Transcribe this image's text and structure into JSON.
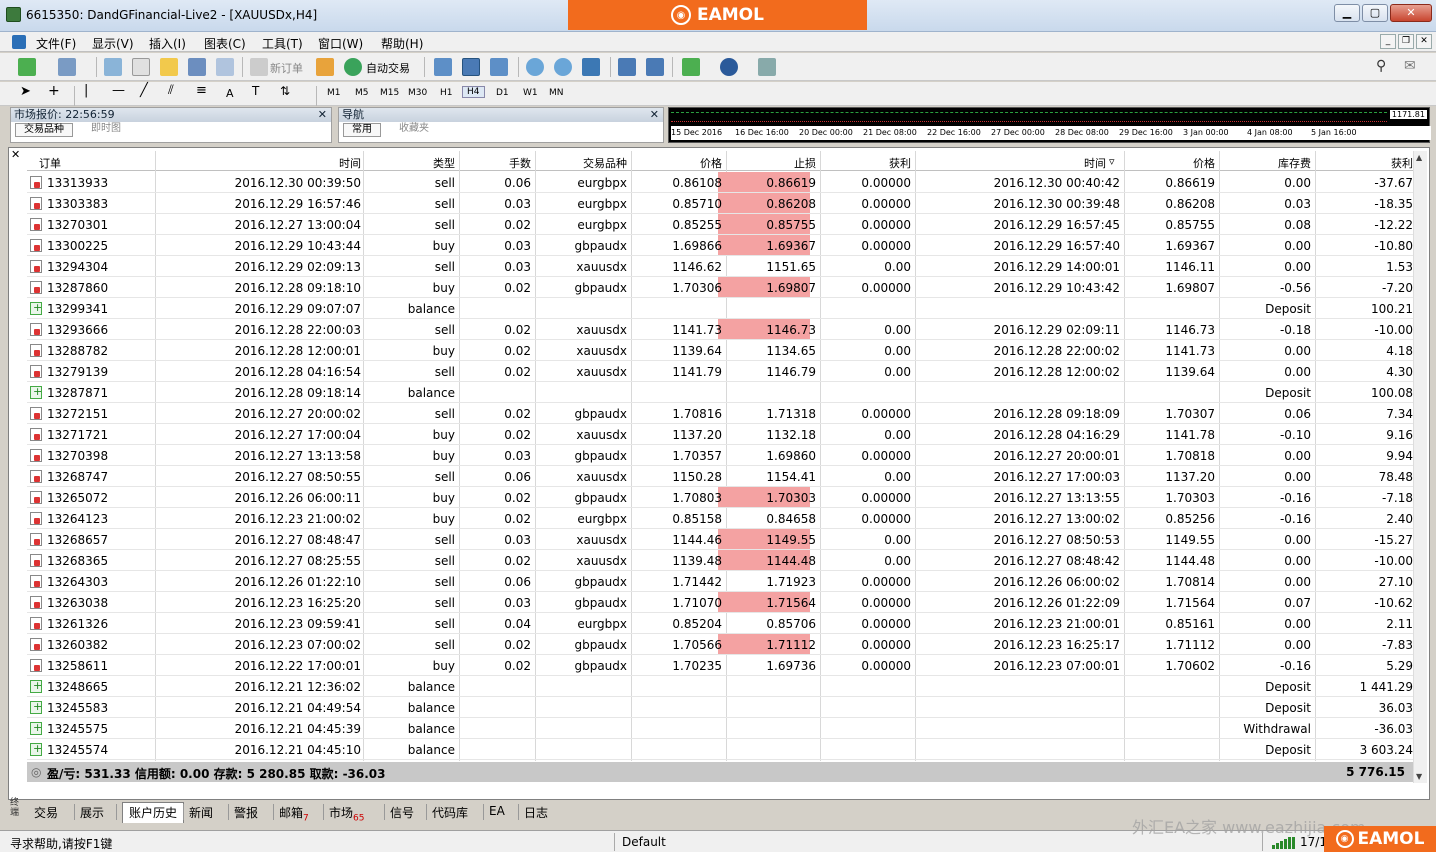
{
  "window": {
    "title": "6615350: DandGFinancial-Live2 - [XAUUSDx,H4]",
    "banner": "EAMOL"
  },
  "menu": [
    "文件(F)",
    "显示(V)",
    "插入(I)",
    "图表(C)",
    "工具(T)",
    "窗口(W)",
    "帮助(H)"
  ],
  "toolbar": {
    "new_order": "新订单",
    "auto_trading": "自动交易",
    "timeframes": [
      "M1",
      "M5",
      "M15",
      "M30",
      "H1",
      "H4",
      "D1",
      "W1",
      "MN"
    ],
    "text_tool": "A"
  },
  "panels": {
    "market": {
      "title": "市场报价: 22:56:59",
      "tabs": [
        "交易品种",
        "即时图"
      ]
    },
    "nav": {
      "title": "导航",
      "tabs": [
        "常用",
        "收藏夹"
      ]
    }
  },
  "chart": {
    "price": "1171.81",
    "dates": [
      "15 Dec 2016",
      "16 Dec 16:00",
      "20 Dec 00:00",
      "21 Dec 08:00",
      "22 Dec 16:00",
      "27 Dec 00:00",
      "28 Dec 08:00",
      "29 Dec 16:00",
      "3 Jan 00:00",
      "4 Jan 08:00",
      "5 Jan 16:00"
    ]
  },
  "columns": [
    "订单",
    "时间",
    "类型",
    "手数",
    "交易品种",
    "价格",
    "止损",
    "获利",
    "时间",
    "价格",
    "库存费",
    "获利"
  ],
  "rows": [
    {
      "order": "13313933",
      "open": "2016.12.30 00:39:50",
      "type": "sell",
      "lots": "0.06",
      "sym": "eurgbpx",
      "price": "0.86108",
      "sl": "0.86619",
      "tp": "0.00000",
      "close": "2016.12.30 00:40:42",
      "cprice": "0.86619",
      "swap": "0.00",
      "profit": "-37.67",
      "hit": true
    },
    {
      "order": "13303383",
      "open": "2016.12.29 16:57:46",
      "type": "sell",
      "lots": "0.03",
      "sym": "eurgbpx",
      "price": "0.85710",
      "sl": "0.86208",
      "tp": "0.00000",
      "close": "2016.12.30 00:39:48",
      "cprice": "0.86208",
      "swap": "0.03",
      "profit": "-18.35",
      "hit": true
    },
    {
      "order": "13270301",
      "open": "2016.12.27 13:00:04",
      "type": "sell",
      "lots": "0.02",
      "sym": "eurgbpx",
      "price": "0.85255",
      "sl": "0.85755",
      "tp": "0.00000",
      "close": "2016.12.29 16:57:45",
      "cprice": "0.85755",
      "swap": "0.08",
      "profit": "-12.22",
      "hit": true
    },
    {
      "order": "13300225",
      "open": "2016.12.29 10:43:44",
      "type": "buy",
      "lots": "0.03",
      "sym": "gbpaudx",
      "price": "1.69866",
      "sl": "1.69367",
      "tp": "0.00000",
      "close": "2016.12.29 16:57:40",
      "cprice": "1.69367",
      "swap": "0.00",
      "profit": "-10.80",
      "hit": true
    },
    {
      "order": "13294304",
      "open": "2016.12.29 02:09:13",
      "type": "sell",
      "lots": "0.03",
      "sym": "xauusdx",
      "price": "1146.62",
      "sl": "1151.65",
      "tp": "0.00",
      "close": "2016.12.29 14:00:01",
      "cprice": "1146.11",
      "swap": "0.00",
      "profit": "1.53",
      "hit": false
    },
    {
      "order": "13287860",
      "open": "2016.12.28 09:18:10",
      "type": "buy",
      "lots": "0.02",
      "sym": "gbpaudx",
      "price": "1.70306",
      "sl": "1.69807",
      "tp": "0.00000",
      "close": "2016.12.29 10:43:42",
      "cprice": "1.69807",
      "swap": "-0.56",
      "profit": "-7.20",
      "hit": true
    },
    {
      "order": "13299341",
      "open": "2016.12.29 09:07:07",
      "type": "balance",
      "comment": "Deposit",
      "profit": "100.21"
    },
    {
      "order": "13293666",
      "open": "2016.12.28 22:00:03",
      "type": "sell",
      "lots": "0.02",
      "sym": "xauusdx",
      "price": "1141.73",
      "sl": "1146.73",
      "tp": "0.00",
      "close": "2016.12.29 02:09:11",
      "cprice": "1146.73",
      "swap": "-0.18",
      "profit": "-10.00",
      "hit": true
    },
    {
      "order": "13288782",
      "open": "2016.12.28 12:00:01",
      "type": "buy",
      "lots": "0.02",
      "sym": "xauusdx",
      "price": "1139.64",
      "sl": "1134.65",
      "tp": "0.00",
      "close": "2016.12.28 22:00:02",
      "cprice": "1141.73",
      "swap": "0.00",
      "profit": "4.18",
      "hit": false
    },
    {
      "order": "13279139",
      "open": "2016.12.28 04:16:54",
      "type": "sell",
      "lots": "0.02",
      "sym": "xauusdx",
      "price": "1141.79",
      "sl": "1146.79",
      "tp": "0.00",
      "close": "2016.12.28 12:00:02",
      "cprice": "1139.64",
      "swap": "0.00",
      "profit": "4.30",
      "hit": false
    },
    {
      "order": "13287871",
      "open": "2016.12.28 09:18:14",
      "type": "balance",
      "comment": "Deposit",
      "profit": "100.08"
    },
    {
      "order": "13272151",
      "open": "2016.12.27 20:00:02",
      "type": "sell",
      "lots": "0.02",
      "sym": "gbpaudx",
      "price": "1.70816",
      "sl": "1.71318",
      "tp": "0.00000",
      "close": "2016.12.28 09:18:09",
      "cprice": "1.70307",
      "swap": "0.06",
      "profit": "7.34",
      "hit": false
    },
    {
      "order": "13271721",
      "open": "2016.12.27 17:00:04",
      "type": "buy",
      "lots": "0.02",
      "sym": "xauusdx",
      "price": "1137.20",
      "sl": "1132.18",
      "tp": "0.00",
      "close": "2016.12.28 04:16:29",
      "cprice": "1141.78",
      "swap": "-0.10",
      "profit": "9.16",
      "hit": false
    },
    {
      "order": "13270398",
      "open": "2016.12.27 13:13:58",
      "type": "buy",
      "lots": "0.03",
      "sym": "gbpaudx",
      "price": "1.70357",
      "sl": "1.69860",
      "tp": "0.00000",
      "close": "2016.12.27 20:00:01",
      "cprice": "1.70818",
      "swap": "0.00",
      "profit": "9.94",
      "hit": false
    },
    {
      "order": "13268747",
      "open": "2016.12.27 08:50:55",
      "type": "sell",
      "lots": "0.06",
      "sym": "xauusdx",
      "price": "1150.28",
      "sl": "1154.41",
      "tp": "0.00",
      "close": "2016.12.27 17:00:03",
      "cprice": "1137.20",
      "swap": "0.00",
      "profit": "78.48",
      "hit": false
    },
    {
      "order": "13265072",
      "open": "2016.12.26 06:00:11",
      "type": "buy",
      "lots": "0.02",
      "sym": "gbpaudx",
      "price": "1.70803",
      "sl": "1.70303",
      "tp": "0.00000",
      "close": "2016.12.27 13:13:55",
      "cprice": "1.70303",
      "swap": "-0.16",
      "profit": "-7.18",
      "hit": true
    },
    {
      "order": "13264123",
      "open": "2016.12.23 21:00:02",
      "type": "buy",
      "lots": "0.02",
      "sym": "eurgbpx",
      "price": "0.85158",
      "sl": "0.84658",
      "tp": "0.00000",
      "close": "2016.12.27 13:00:02",
      "cprice": "0.85256",
      "swap": "-0.16",
      "profit": "2.40",
      "hit": false
    },
    {
      "order": "13268657",
      "open": "2016.12.27 08:48:47",
      "type": "sell",
      "lots": "0.03",
      "sym": "xauusdx",
      "price": "1144.46",
      "sl": "1149.55",
      "tp": "0.00",
      "close": "2016.12.27 08:50:53",
      "cprice": "1149.55",
      "swap": "0.00",
      "profit": "-15.27",
      "hit": true
    },
    {
      "order": "13268365",
      "open": "2016.12.27 08:25:55",
      "type": "sell",
      "lots": "0.02",
      "sym": "xauusdx",
      "price": "1139.48",
      "sl": "1144.48",
      "tp": "0.00",
      "close": "2016.12.27 08:48:42",
      "cprice": "1144.48",
      "swap": "0.00",
      "profit": "-10.00",
      "hit": true
    },
    {
      "order": "13264303",
      "open": "2016.12.26 01:22:10",
      "type": "sell",
      "lots": "0.06",
      "sym": "gbpaudx",
      "price": "1.71442",
      "sl": "1.71923",
      "tp": "0.00000",
      "close": "2016.12.26 06:00:02",
      "cprice": "1.70814",
      "swap": "0.00",
      "profit": "27.10",
      "hit": false
    },
    {
      "order": "13263038",
      "open": "2016.12.23 16:25:20",
      "type": "sell",
      "lots": "0.03",
      "sym": "gbpaudx",
      "price": "1.71070",
      "sl": "1.71564",
      "tp": "0.00000",
      "close": "2016.12.26 01:22:09",
      "cprice": "1.71564",
      "swap": "0.07",
      "profit": "-10.62",
      "hit": true
    },
    {
      "order": "13261326",
      "open": "2016.12.23 09:59:41",
      "type": "sell",
      "lots": "0.04",
      "sym": "eurgbpx",
      "price": "0.85204",
      "sl": "0.85706",
      "tp": "0.00000",
      "close": "2016.12.23 21:00:01",
      "cprice": "0.85161",
      "swap": "0.00",
      "profit": "2.11",
      "hit": false
    },
    {
      "order": "13260382",
      "open": "2016.12.23 07:00:02",
      "type": "sell",
      "lots": "0.02",
      "sym": "gbpaudx",
      "price": "1.70566",
      "sl": "1.71112",
      "tp": "0.00000",
      "close": "2016.12.23 16:25:17",
      "cprice": "1.71112",
      "swap": "0.00",
      "profit": "-7.83",
      "hit": true
    },
    {
      "order": "13258611",
      "open": "2016.12.22 17:00:01",
      "type": "buy",
      "lots": "0.02",
      "sym": "gbpaudx",
      "price": "1.70235",
      "sl": "1.69736",
      "tp": "0.00000",
      "close": "2016.12.23 07:00:01",
      "cprice": "1.70602",
      "swap": "-0.16",
      "profit": "5.29",
      "hit": false
    },
    {
      "order": "13248665",
      "open": "2016.12.21 12:36:02",
      "type": "balance",
      "comment": "Deposit",
      "profit": "1 441.29"
    },
    {
      "order": "13245583",
      "open": "2016.12.21 04:49:54",
      "type": "balance",
      "comment": "Deposit",
      "profit": "36.03"
    },
    {
      "order": "13245575",
      "open": "2016.12.21 04:45:39",
      "type": "balance",
      "comment": "Withdrawal",
      "profit": "-36.03"
    },
    {
      "order": "13245574",
      "open": "2016.12.21 04:45:10",
      "type": "balance",
      "comment": "Deposit",
      "profit": "3 603.24"
    }
  ],
  "totals": {
    "summary": "盈/亏: 531.33  信用额: 0.00  存款: 5 280.85  取款: -36.03",
    "total": "5 776.15"
  },
  "bottom_tabs": [
    {
      "label": "交易"
    },
    {
      "label": "展示"
    },
    {
      "label": "账户历史",
      "active": true
    },
    {
      "label": "新闻"
    },
    {
      "label": "警报"
    },
    {
      "label": "邮箱",
      "badge": "7"
    },
    {
      "label": "市场",
      "badge": "65"
    },
    {
      "label": "信号"
    },
    {
      "label": "代码库"
    },
    {
      "label": "EA"
    },
    {
      "label": "日志"
    }
  ],
  "side_label": "终端",
  "status": {
    "help": "寻求帮助,请按F1键",
    "profile": "Default",
    "conn": "17/1",
    "watermark": "外汇EA之家 www.eazhijia.com",
    "logo": "EAMOL"
  }
}
